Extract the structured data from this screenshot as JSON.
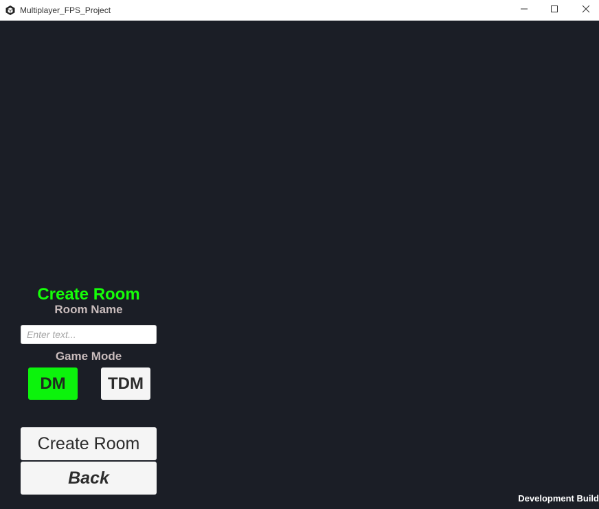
{
  "window": {
    "title": "Multiplayer_FPS_Project",
    "app_icon": "unity-cube-icon",
    "controls": {
      "minimize_icon": "minimize-icon",
      "maximize_icon": "maximize-icon",
      "close_icon": "close-icon"
    }
  },
  "create_room_panel": {
    "title": "Create Room",
    "room_name_label": "Room Name",
    "room_name_input": {
      "value": "",
      "placeholder": "Enter text..."
    },
    "game_mode_label": "Game Mode",
    "game_modes": [
      {
        "label": "DM",
        "selected": true
      },
      {
        "label": "TDM",
        "selected": false
      }
    ],
    "create_button_label": "Create Room",
    "back_button_label": "Back"
  },
  "footer": {
    "dev_build_text": "Development Build"
  },
  "colors": {
    "background": "#1b1e26",
    "title_green": "#15ff08",
    "selected_mode": "#0cf30c",
    "label_gray": "#c9bcbc",
    "button_bg": "#f5f5f5"
  }
}
